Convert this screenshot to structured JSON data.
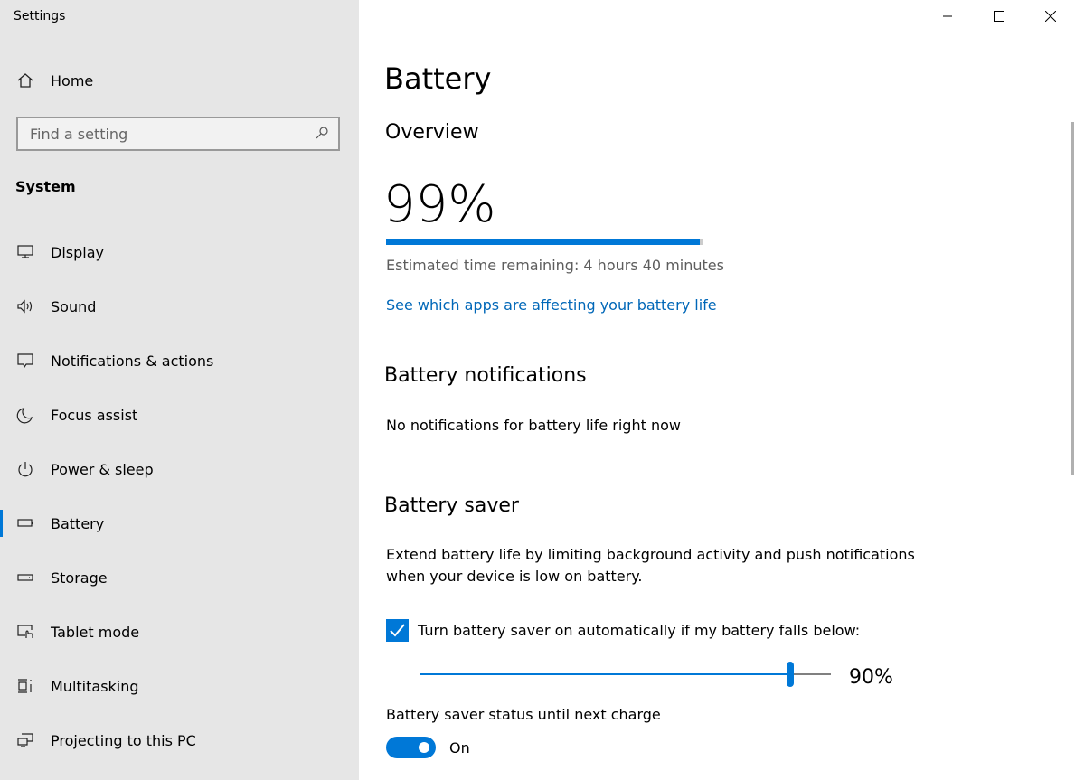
{
  "window": {
    "title": "Settings"
  },
  "sidebar": {
    "home": "Home",
    "search_placeholder": "Find a setting",
    "section": "System",
    "items": [
      {
        "label": "Display",
        "icon": "monitor-icon"
      },
      {
        "label": "Sound",
        "icon": "speaker-icon"
      },
      {
        "label": "Notifications & actions",
        "icon": "notification-icon"
      },
      {
        "label": "Focus assist",
        "icon": "moon-icon"
      },
      {
        "label": "Power & sleep",
        "icon": "power-icon"
      },
      {
        "label": "Battery",
        "icon": "battery-icon",
        "selected": true
      },
      {
        "label": "Storage",
        "icon": "storage-icon"
      },
      {
        "label": "Tablet mode",
        "icon": "tablet-icon"
      },
      {
        "label": "Multitasking",
        "icon": "multitasking-icon"
      },
      {
        "label": "Projecting to this PC",
        "icon": "projecting-icon"
      }
    ]
  },
  "main": {
    "title": "Battery",
    "overview": {
      "heading": "Overview",
      "percent": "99%",
      "level": 99,
      "estimate": "Estimated time remaining: 4 hours 40 minutes",
      "link": "See which apps are affecting your battery life"
    },
    "notifications": {
      "heading": "Battery notifications",
      "text": "No notifications for battery life right now"
    },
    "saver": {
      "heading": "Battery saver",
      "desc1": "Extend battery life by limiting background activity and push notifications",
      "desc2": "when your device is low on battery.",
      "checkbox_label": "Turn battery saver on automatically if my battery falls below:",
      "checked": true,
      "threshold": 90,
      "threshold_label": "90%",
      "status_label": "Battery saver status until next charge",
      "toggle_state": "On"
    }
  },
  "colors": {
    "accent": "#0078d7",
    "link": "#0067b8",
    "sidebar_bg": "#e6e6e6"
  }
}
